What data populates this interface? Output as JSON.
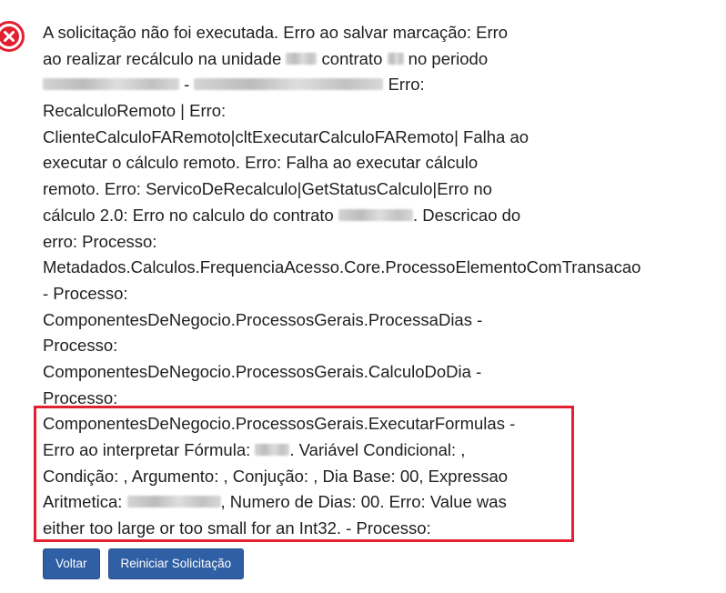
{
  "error_icon": "error-circle-x-icon",
  "accent_color": "#e3202f",
  "button_color": "#2f5fa4",
  "message_lines": [
    [
      "A solicitação não foi executada. Erro ao salvar marcação: Erro"
    ],
    [
      "ao realizar recálculo na unidade ",
      {
        "redacted": 34
      },
      " contrato ",
      {
        "redacted": 18
      },
      " no periodo"
    ],
    [
      {
        "redacted": 150
      },
      " - ",
      {
        "redacted": 208
      },
      " Erro:"
    ],
    [
      "RecalculoRemoto | Erro:"
    ],
    [
      "ClienteCalculoFARemoto|cltExecutarCalculoFARemoto| Falha ao"
    ],
    [
      "executar o cálculo remoto. Erro: Falha ao executar cálculo"
    ],
    [
      "remoto. Erro: ServicoDeRecalculo|GetStatusCalculo|Erro no"
    ],
    [
      "cálculo 2.0: Erro no calculo do contrato ",
      {
        "redacted": 82
      },
      ". Descricao do"
    ],
    [
      "erro: Processo:"
    ],
    [
      "Metadados.Calculos.FrequenciaAcesso.Core.ProcessoElementoComTransacao"
    ],
    [
      "- Processo:"
    ],
    [
      "ComponentesDeNegocio.ProcessosGerais.ProcessaDias -"
    ],
    [
      "Processo:"
    ],
    [
      "ComponentesDeNegocio.ProcessosGerais.CalculoDoDia -"
    ],
    [
      "Processo:"
    ],
    [
      "ComponentesDeNegocio.ProcessosGerais.ExecutarFormulas -"
    ],
    [
      "Erro ao interpretar Fórmula: ",
      {
        "redacted": 38
      },
      ". Variável Condicional: ,"
    ],
    [
      "Condição: , Argumento: , Conjução: , Dia Base: 00, Expressao"
    ],
    [
      "Aritmetica: ",
      {
        "redacted": 103
      },
      ", Numero de Dias: 00. Erro: Value was"
    ],
    [
      "either too large or too small for an Int32. - Processo:"
    ]
  ],
  "buttons": {
    "back_label": "Voltar",
    "restart_label": "Reiniciar Solicitação"
  }
}
